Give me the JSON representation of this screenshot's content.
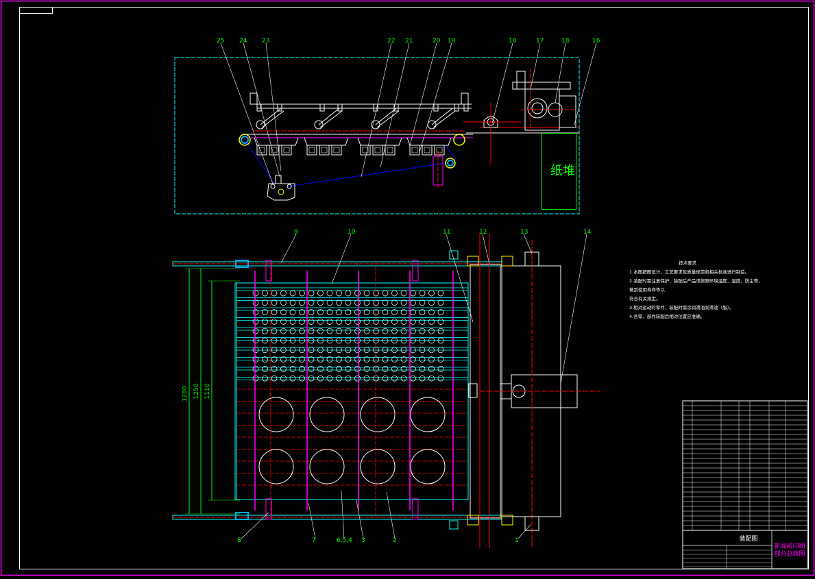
{
  "drawing": {
    "top_view_labels": [
      "25",
      "24",
      "23",
      "22",
      "21",
      "20",
      "19",
      "18",
      "17",
      "16"
    ],
    "main_view_top_labels": [
      "9",
      "10",
      "11",
      "12",
      "13",
      "14"
    ],
    "main_view_bottom_labels": [
      "8",
      "7",
      "6,5,4",
      "3",
      "2",
      "1"
    ],
    "dimensions": [
      "1280",
      "1250",
      "1110"
    ],
    "paper_stack_label": "纸堆"
  },
  "technical_requirements": {
    "title": "技术要求",
    "items": [
      "1.本图按图设计，工艺要求及质量规范和相关标准进行制造。",
      "2.装配时需注意保护，装配后产品须按照环境温度、湿度、防尘等，做到使用寿命等以",
      "符合有关规定。",
      "3.相对运动的零件，装配时需涂润滑油润滑油（脂）。",
      "4.各零、部件装配后相对位置应准确。"
    ]
  },
  "title_block": {
    "name_line1": "新闻纸印刷",
    "name_line2": "部分总装图",
    "drawing_type": "装配图"
  },
  "colors": {
    "background": "#000000",
    "frame": "#ff00ff",
    "cyan": "#00ffff",
    "green": "#00ff00",
    "white": "#ffffff",
    "red": "#ff0000",
    "blue": "#0000ff",
    "magenta": "#ff00ff",
    "yellow": "#ffff00"
  }
}
